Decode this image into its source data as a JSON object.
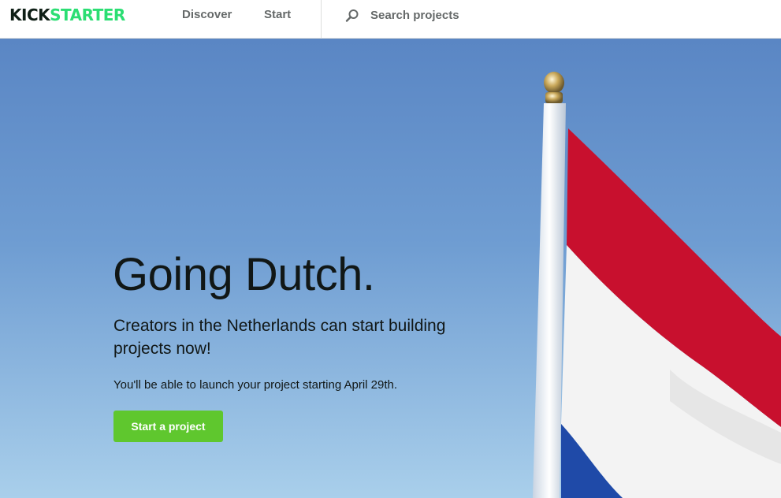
{
  "header": {
    "logo": {
      "part1": "KICK",
      "part2": "STARTER"
    },
    "nav": {
      "discover": "Discover",
      "start": "Start"
    },
    "search": {
      "placeholder": "Search projects",
      "icon": "search-icon"
    }
  },
  "hero": {
    "title": "Going Dutch.",
    "subtitle": "Creators in the Netherlands can start building projects now!",
    "note": "You'll be able to launch your project starting April 29th.",
    "cta_label": "Start a project",
    "image": "netherlands-flag-photo"
  },
  "colors": {
    "brand_dark": "#0f1f16",
    "brand_green": "#2bde73",
    "cta_green": "#5fc72e",
    "sky": "#6b98cf",
    "flag_red": "#c8102e",
    "flag_white": "#f3f3f3",
    "flag_blue": "#1f4aa8"
  }
}
